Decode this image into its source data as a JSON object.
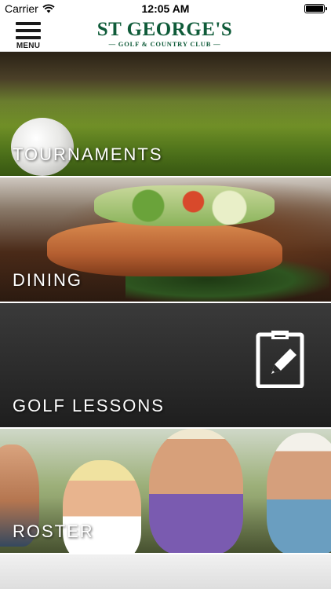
{
  "status_bar": {
    "carrier": "Carrier",
    "time": "12:05 AM"
  },
  "header": {
    "menu_label": "MENU",
    "logo_title": "ST GEORGE'S",
    "logo_subtitle": "— GOLF & COUNTRY CLUB —"
  },
  "tiles": [
    {
      "label": "TOURNAMENTS",
      "icon": "golf-ball-photo"
    },
    {
      "label": "DINING",
      "icon": "salmon-dish-photo"
    },
    {
      "label": "GOLF LESSONS",
      "icon": "clipboard-pencil-icon"
    },
    {
      "label": "ROSTER",
      "icon": "golfers-group-photo"
    }
  ],
  "colors": {
    "brand_green": "#0f5b39",
    "lessons_bg": "#2a2a2a"
  }
}
